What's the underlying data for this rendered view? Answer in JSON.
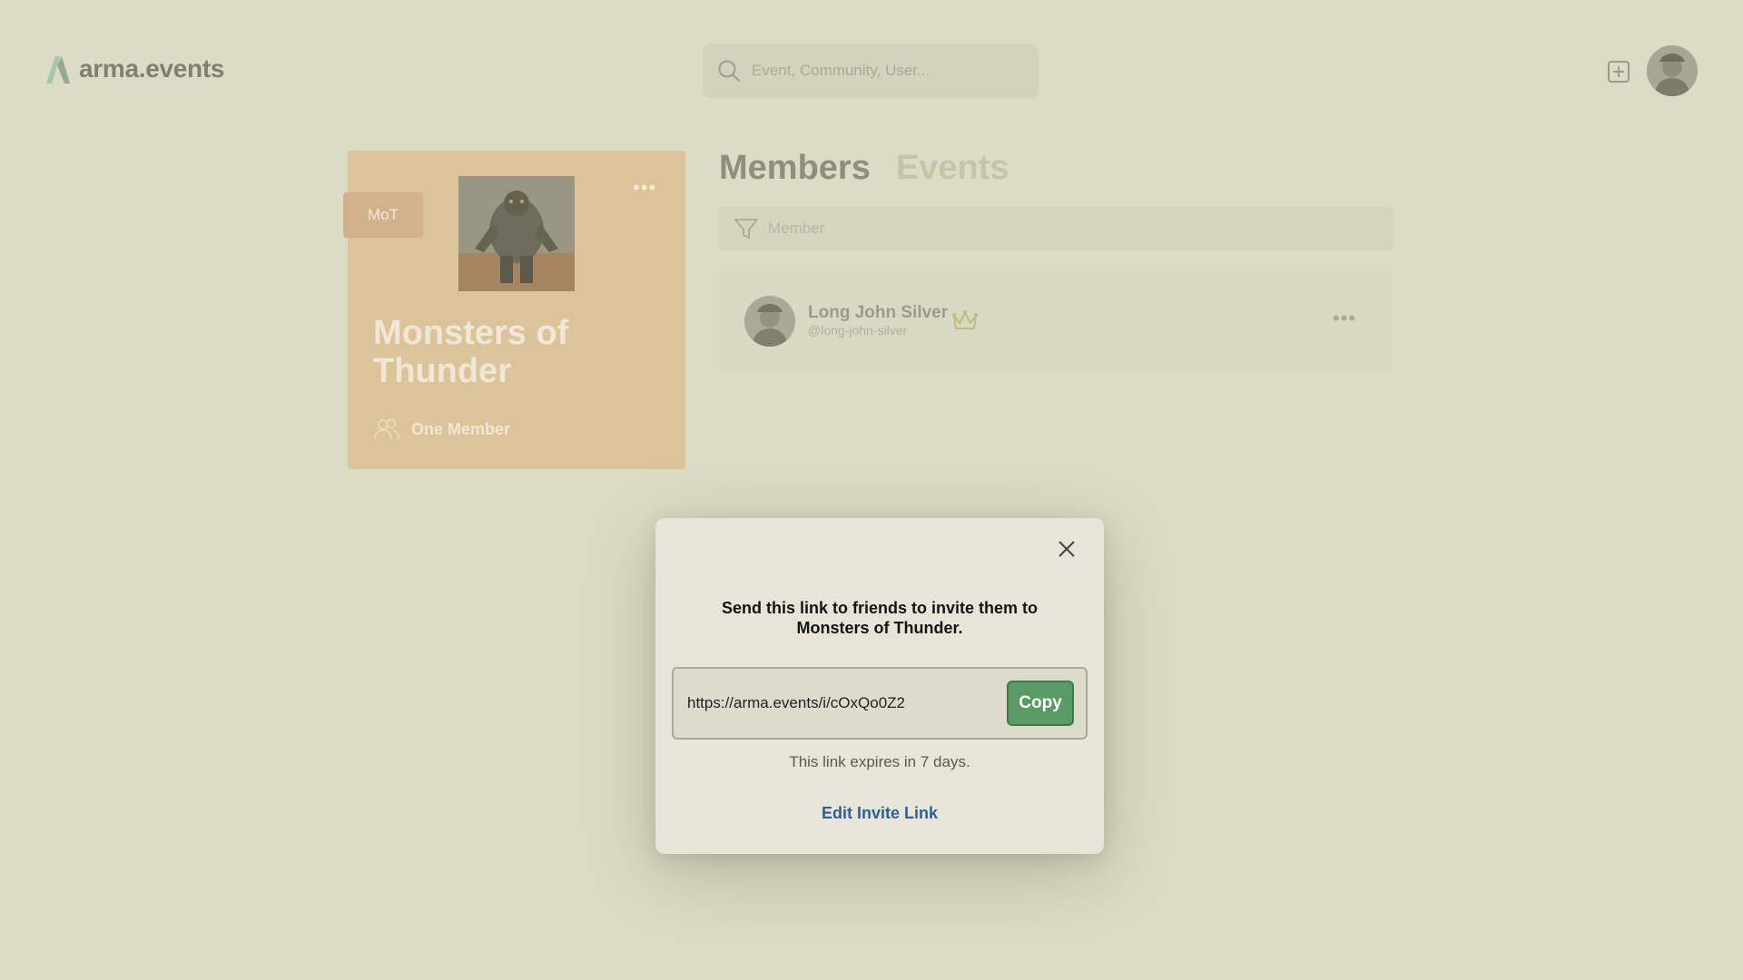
{
  "header": {
    "logo_text": "arma.events",
    "search_placeholder": "Event, Community, User..."
  },
  "community": {
    "abbreviation": "MoT",
    "title": "Monsters of Thunder",
    "member_count": "One Member"
  },
  "tabs": [
    {
      "label": "Members",
      "active": true
    },
    {
      "label": "Events",
      "active": false
    }
  ],
  "filter": {
    "placeholder": "Member"
  },
  "members": [
    {
      "name": "Long John Silver",
      "handle": "@long-john-silver",
      "role_icon": "crown-icon"
    }
  ],
  "modal": {
    "message": "Send this link to friends to invite them to Monsters of Thunder.",
    "invite_url": "https://arma.events/i/cOxQo0Z2",
    "copy_label": "Copy",
    "expiry_text": "This link expires in 7 days.",
    "edit_label": "Edit Invite Link"
  },
  "colors": {
    "background": "#dcdbc5",
    "card": "#dcc39a",
    "accent_green": "#5a9a64",
    "link_blue": "#2f5f96"
  }
}
